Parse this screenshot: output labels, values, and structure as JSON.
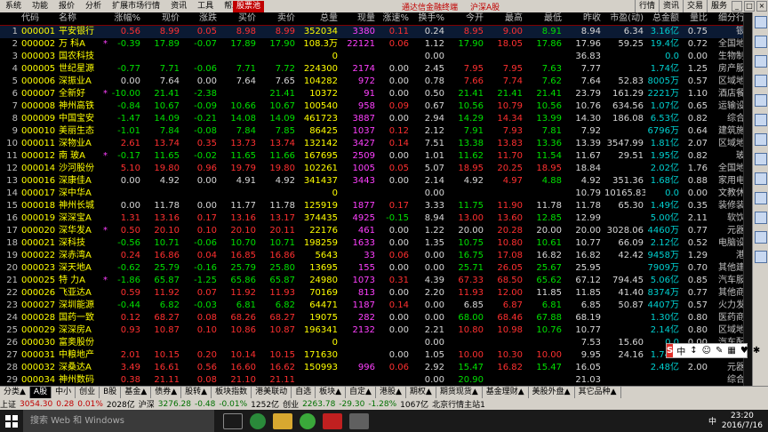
{
  "menu": {
    "items": [
      "系统",
      "功能",
      "报价",
      "分析",
      "扩展市场行情",
      "资讯",
      "工具",
      "帮助"
    ],
    "active_tab": "股票池",
    "mid_links": [
      "通达信金融终端",
      "沪深A股"
    ],
    "right_buttons": [
      "行情",
      "资讯",
      "交易",
      "服务"
    ]
  },
  "table": {
    "headers": [
      "",
      "代码",
      "名称",
      "",
      "涨幅%",
      "现价",
      "涨跌",
      "买价",
      "卖价",
      "总量",
      "现量",
      "涨速%",
      "换手%",
      "今开",
      "最高",
      "最低",
      "昨收",
      "市盈(动)",
      "总金额",
      "量比",
      "细分行业"
    ],
    "rows": [
      [
        "1",
        "000001",
        "平安银行",
        "",
        "0.56",
        "8.99",
        "0.05",
        "8.98",
        "8.99",
        "352034",
        "3380",
        "0.11",
        "0.24",
        "8.95",
        "9.00",
        "8.91",
        "8.94",
        "6.34",
        "3.16亿",
        "0.75",
        "银行"
      ],
      [
        "2",
        "000002",
        "万 科A",
        "*",
        "-0.39",
        "17.89",
        "-0.07",
        "17.89",
        "17.90",
        "108.3万",
        "22121",
        "0.06",
        "1.12",
        "17.90",
        "18.05",
        "17.86",
        "17.96",
        "59.25",
        "19.4亿",
        "0.72",
        "全国地产"
      ],
      [
        "3",
        "000003",
        "国农科技",
        "",
        "",
        "",
        "",
        "",
        "",
        "0",
        "",
        "",
        "0.00",
        "",
        "",
        "",
        "36.83",
        "",
        "0.0",
        "0.00",
        "生物制药"
      ],
      [
        "4",
        "000005",
        "世纪星源",
        "",
        "-0.77",
        "7.71",
        "-0.06",
        "7.71",
        "7.72",
        "224300",
        "2174",
        "0.00",
        "2.45",
        "7.95",
        "7.95",
        "7.63",
        "7.77",
        "",
        "1.74亿",
        "1.25",
        "房产服务"
      ],
      [
        "5",
        "000006",
        "深振业A",
        "",
        "0.00",
        "7.64",
        "0.00",
        "7.64",
        "7.65",
        "104282",
        "972",
        "0.00",
        "0.78",
        "7.66",
        "7.74",
        "7.62",
        "7.64",
        "52.83",
        "8005万",
        "0.57",
        "区域地产"
      ],
      [
        "6",
        "000007",
        "全新好",
        "*",
        "-10.00",
        "21.41",
        "-2.38",
        "",
        "21.41",
        "10372",
        "91",
        "0.00",
        "0.50",
        "21.41",
        "21.41",
        "21.41",
        "23.79",
        "161.29",
        "2221万",
        "1.10",
        "酒店餐饮"
      ],
      [
        "7",
        "000008",
        "神州高铁",
        "",
        "-0.84",
        "10.67",
        "-0.09",
        "10.66",
        "10.67",
        "100540",
        "958",
        "0.09",
        "0.67",
        "10.56",
        "10.79",
        "10.56",
        "10.76",
        "634.56",
        "1.07亿",
        "0.65",
        "运输设备"
      ],
      [
        "8",
        "000009",
        "中国宝安",
        "",
        "-1.47",
        "14.09",
        "-0.21",
        "14.08",
        "14.09",
        "461723",
        "3887",
        "0.00",
        "2.94",
        "14.29",
        "14.34",
        "13.99",
        "14.30",
        "186.08",
        "6.53亿",
        "0.82",
        "综合类"
      ],
      [
        "9",
        "000010",
        "美丽生态",
        "",
        "-1.01",
        "7.84",
        "-0.08",
        "7.84",
        "7.85",
        "86425",
        "1037",
        "0.12",
        "2.12",
        "7.91",
        "7.93",
        "7.81",
        "7.92",
        "",
        "6796万",
        "0.64",
        "建筑施工"
      ],
      [
        "10",
        "000011",
        "深物业A",
        "",
        "2.61",
        "13.74",
        "0.35",
        "13.73",
        "13.74",
        "132142",
        "3427",
        "0.14",
        "7.51",
        "13.38",
        "13.83",
        "13.36",
        "13.39",
        "3547.99",
        "1.81亿",
        "2.07",
        "区域地产"
      ],
      [
        "11",
        "000012",
        "南 玻A",
        "*",
        "-0.17",
        "11.65",
        "-0.02",
        "11.65",
        "11.66",
        "167695",
        "2509",
        "0.00",
        "1.01",
        "11.62",
        "11.70",
        "11.54",
        "11.67",
        "29.51",
        "1.95亿",
        "0.82",
        "玻璃"
      ],
      [
        "12",
        "000014",
        "沙河股份",
        "",
        "5.10",
        "19.80",
        "0.96",
        "19.79",
        "19.80",
        "102261",
        "1005",
        "0.05",
        "5.07",
        "18.95",
        "20.25",
        "18.95",
        "18.84",
        "",
        "2.02亿",
        "1.76",
        "全国地产"
      ],
      [
        "13",
        "000016",
        "深康佳A",
        "",
        "0.00",
        "4.92",
        "0.00",
        "4.91",
        "4.92",
        "341437",
        "3443",
        "0.00",
        "2.14",
        "4.92",
        "4.97",
        "4.88",
        "4.92",
        "351.36",
        "1.68亿",
        "0.88",
        "家用电器"
      ],
      [
        "14",
        "000017",
        "深中华A",
        "",
        "",
        "",
        "",
        "",
        "",
        "0",
        "",
        "",
        "0.00",
        "",
        "",
        "",
        "10.79",
        "10165.83",
        "0.0",
        "0.00",
        "文教休闲"
      ],
      [
        "15",
        "000018",
        "神州长城",
        "",
        "0.00",
        "11.78",
        "0.00",
        "11.77",
        "11.78",
        "125919",
        "1877",
        "0.17",
        "3.33",
        "11.75",
        "11.90",
        "11.78",
        "11.78",
        "65.30",
        "1.49亿",
        "0.35",
        "装修装饰"
      ],
      [
        "16",
        "000019",
        "深深宝A",
        "",
        "1.31",
        "13.16",
        "0.17",
        "13.16",
        "13.17",
        "374435",
        "4925",
        "-0.15",
        "8.94",
        "13.00",
        "13.60",
        "12.85",
        "12.99",
        "",
        "5.00亿",
        "2.11",
        "软饮料"
      ],
      [
        "17",
        "000020",
        "深华发A",
        "*",
        "0.50",
        "20.10",
        "0.10",
        "20.10",
        "20.11",
        "22176",
        "461",
        "0.00",
        "1.22",
        "20.00",
        "20.28",
        "20.00",
        "20.00",
        "3028.06",
        "4460万",
        "0.77",
        "元器件"
      ],
      [
        "18",
        "000021",
        "深科技",
        "",
        "-0.56",
        "10.71",
        "-0.06",
        "10.70",
        "10.71",
        "198259",
        "1633",
        "0.00",
        "1.35",
        "10.75",
        "10.80",
        "10.61",
        "10.77",
        "66.09",
        "2.12亿",
        "0.52",
        "电脑设备"
      ],
      [
        "19",
        "000022",
        "深赤湾A",
        "",
        "0.24",
        "16.86",
        "0.04",
        "16.85",
        "16.86",
        "5643",
        "33",
        "0.06",
        "0.00",
        "16.75",
        "17.08",
        "16.82",
        "16.82",
        "42.42",
        "9458万",
        "1.29",
        "港口"
      ],
      [
        "20",
        "000023",
        "深天地A",
        "",
        "-0.62",
        "25.79",
        "-0.16",
        "25.79",
        "25.80",
        "13695",
        "155",
        "0.00",
        "0.00",
        "25.71",
        "26.05",
        "25.67",
        "25.95",
        "",
        "7909万",
        "0.70",
        "其他建材"
      ],
      [
        "21",
        "000025",
        "特 力A",
        "*",
        "-1.86",
        "65.87",
        "-1.25",
        "65.86",
        "65.87",
        "24980",
        "1073",
        "0.31",
        "4.39",
        "67.33",
        "68.50",
        "65.62",
        "67.12",
        "794.45",
        "5.06亿",
        "0.85",
        "汽车服务"
      ],
      [
        "22",
        "000026",
        "飞亚达A",
        "",
        "0.59",
        "11.92",
        "0.07",
        "11.92",
        "11.93",
        "70169",
        "813",
        "0.00",
        "2.20",
        "11.93",
        "12.00",
        "11.85",
        "11.85",
        "41.40",
        "8374万",
        "0.77",
        "其他商业"
      ],
      [
        "23",
        "000027",
        "深圳能源",
        "",
        "-0.44",
        "6.82",
        "-0.03",
        "6.81",
        "6.82",
        "64471",
        "1187",
        "0.14",
        "0.00",
        "6.85",
        "6.87",
        "6.81",
        "6.85",
        "50.87",
        "4407万",
        "0.57",
        "火力发电"
      ],
      [
        "24",
        "000028",
        "国药一致",
        "",
        "0.12",
        "68.27",
        "0.08",
        "68.26",
        "68.27",
        "19075",
        "282",
        "0.00",
        "0.00",
        "68.00",
        "68.46",
        "67.88",
        "68.19",
        "",
        "1.30亿",
        "0.80",
        "医药商业"
      ],
      [
        "25",
        "000029",
        "深深房A",
        "",
        "0.93",
        "10.87",
        "0.10",
        "10.86",
        "10.87",
        "196341",
        "2132",
        "0.00",
        "2.21",
        "10.80",
        "10.98",
        "10.76",
        "10.77",
        "",
        "2.14亿",
        "0.80",
        "区域地产"
      ],
      [
        "26",
        "000030",
        "富奥股份",
        "",
        "",
        "",
        "",
        "",
        "",
        "0",
        "",
        "",
        "0.00",
        "",
        "",
        "",
        "7.53",
        "15.60",
        "0.0",
        "0.00",
        "汽车配件"
      ],
      [
        "27",
        "000031",
        "中粮地产",
        "",
        "2.01",
        "10.15",
        "0.20",
        "10.14",
        "10.15",
        "171630",
        "",
        "0.00",
        "1.05",
        "10.00",
        "10.30",
        "10.00",
        "9.95",
        "24.16",
        "1.74亿",
        "",
        "区域地产"
      ],
      [
        "28",
        "000032",
        "深桑达A",
        "",
        "3.49",
        "16.61",
        "0.56",
        "16.60",
        "16.62",
        "150993",
        "996",
        "0.06",
        "2.92",
        "15.47",
        "16.82",
        "15.47",
        "16.05",
        "",
        "2.48亿",
        "2.00",
        "元器件"
      ],
      [
        "29",
        "000034",
        "神州数码",
        "",
        "0.38",
        "21.11",
        "0.08",
        "21.10",
        "21.11",
        "",
        "",
        "",
        "0.00",
        "20.90",
        "",
        "",
        "21.03",
        "",
        "",
        "",
        "综合类"
      ]
    ]
  },
  "tabs": [
    "分类▲",
    "A股",
    "中小",
    "创业",
    "B股",
    "基金▲",
    "债券▲",
    "股转▲",
    "板块指数",
    "港美联动",
    "自选",
    "板块▲",
    "自定▲",
    "港股▲",
    "期权▲",
    "期货现货▲",
    "基金理财▲",
    "美股外盘▲",
    "其它品种▲"
  ],
  "active_tab_index": 1,
  "status": {
    "sh_label": "上证",
    "sh_value": "3054.30",
    "sh_change": "0.28",
    "sh_pct": "0.01%",
    "sh_amount": "2028亿",
    "hs_label": "沪深",
    "hs_value": "3276.28",
    "hs_change": "-0.48",
    "hs_pct": "-0.01%",
    "hs_amount": "1252亿",
    "cy_label": "创业",
    "cy_value": "2263.78",
    "cy_change": "-29.30",
    "cy_pct": "-1.28%",
    "cy_amount": "1067亿",
    "server": "北京行情主站1"
  },
  "ime": [
    "中",
    "↕",
    "☺",
    "✎",
    "▦",
    "♥",
    "✱"
  ],
  "taskbar": {
    "search_placeholder": "搜索 Web 和 Windows",
    "time": "23:20",
    "date": "2016/7/16",
    "lang": "中"
  },
  "colors": {
    "up": "#ff3030",
    "down": "#00e000",
    "code": "#ffff00",
    "accent": "#c00000"
  }
}
